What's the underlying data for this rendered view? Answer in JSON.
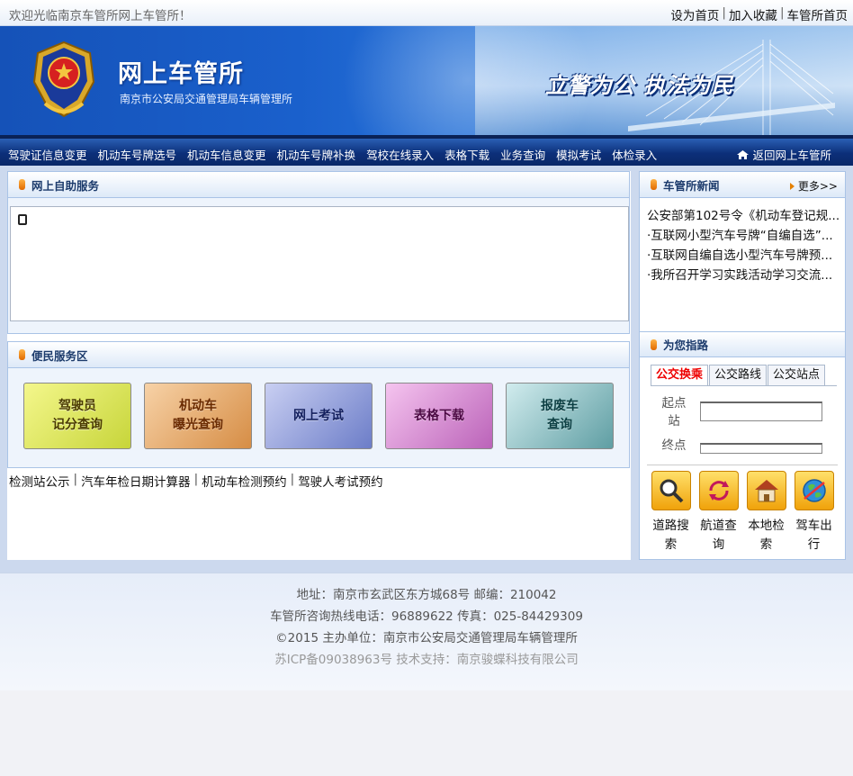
{
  "topbar": {
    "welcome": "欢迎光临南京车管所网上车管所！",
    "links": [
      "设为首页",
      "加入收藏",
      "车管所首页"
    ]
  },
  "banner": {
    "title": "网上车管所",
    "subtitle": "南京市公安局交通管理局车辆管理所",
    "slogan": "立警为公  执法为民"
  },
  "nav": {
    "items": [
      "驾驶证信息变更",
      "机动车号牌选号",
      "机动车信息变更",
      "机动车号牌补换",
      "驾校在线录入",
      "表格下载",
      "业务查询",
      "模拟考试",
      "体检录入"
    ],
    "back": "返回网上车管所"
  },
  "self_service": {
    "title": "网上自助服务"
  },
  "convenience": {
    "title": "便民服务区",
    "buttons": [
      {
        "line1": "驾驶员",
        "line2": "记分查询"
      },
      {
        "line1": "机动车",
        "line2": "曝光查询"
      },
      {
        "line1": "网上考试",
        "line2": ""
      },
      {
        "line1": "表格下载",
        "line2": ""
      },
      {
        "line1": "报废车",
        "line2": "查询"
      }
    ]
  },
  "bottom_links": [
    "检测站公示",
    "汽车年检日期计算器",
    "机动车检测预约",
    "驾驶人考试预约"
  ],
  "news": {
    "title": "车管所新闻",
    "more": "更多>>",
    "items": [
      "公安部第102号令《机动车登记规...",
      "·互联网小型汽车号牌“自编自选”...",
      "·互联网自编自选小型汽车号牌预...",
      "·我所召开学习实践活动学习交流..."
    ]
  },
  "guide": {
    "title": "为您指路",
    "tabs": [
      "公交换乘",
      "公交路线",
      "公交站点"
    ],
    "start_label": "起点站",
    "end_label": "终点",
    "start_value": "",
    "end_value": "",
    "icons": [
      {
        "icon": "magnifier-icon",
        "label": "道路搜索"
      },
      {
        "icon": "route-arrows-icon",
        "label": "航道查询"
      },
      {
        "icon": "house-icon",
        "label": "本地检索"
      },
      {
        "icon": "globe-icon",
        "label": "驾车出行"
      }
    ]
  },
  "footer": {
    "address": "地址：南京市玄武区东方城68号 邮编：210042",
    "hotline": "车管所咨询热线电话：96889622 传真：025-84429309",
    "copyright": "©2015 主办单位：南京市公安局交通管理局车辆管理所",
    "icp": "苏ICP备09038963号 技术支持：南京骏蝶科技有限公司"
  },
  "colors": {
    "nav_bg": "#0c2f79",
    "banner_blue": "#1552b8",
    "panel_border": "#a9c3e6",
    "accent_orange": "#e06a00",
    "active_tab": "#e00000"
  }
}
